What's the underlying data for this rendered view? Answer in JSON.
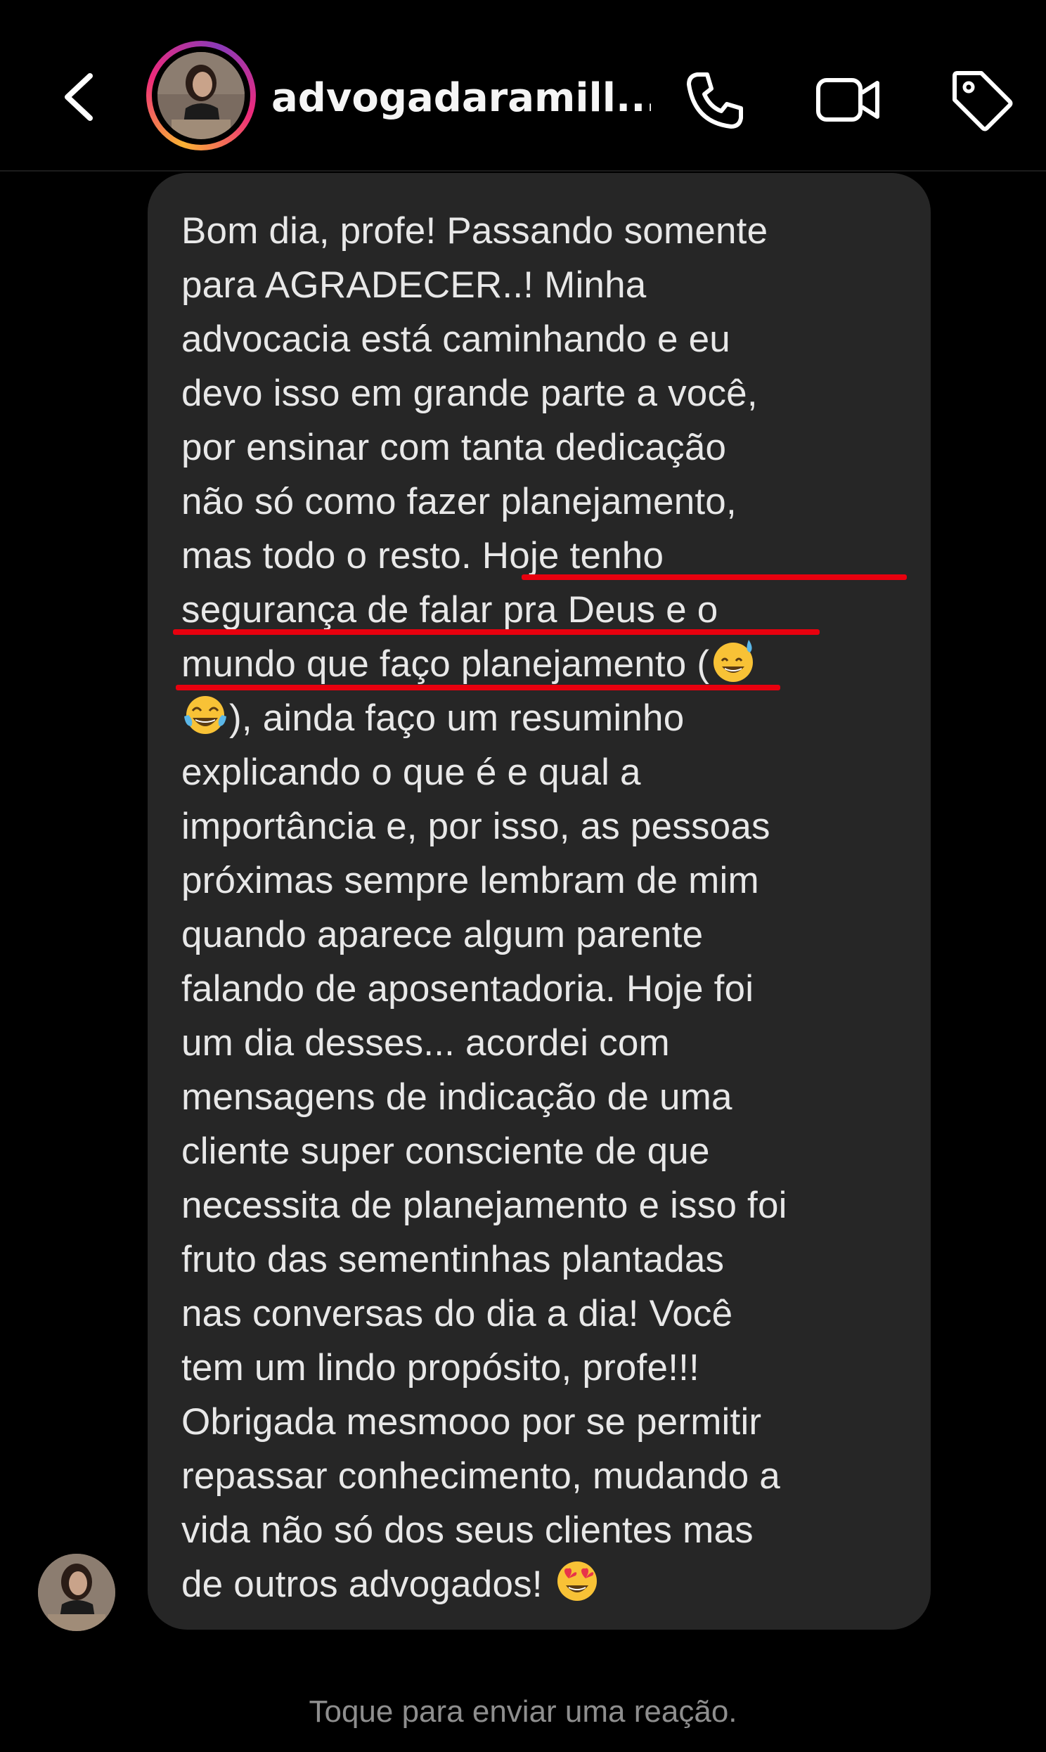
{
  "header": {
    "back_icon": "chevron-left-icon",
    "username": "advogadaramill...",
    "actions": [
      {
        "icon": "phone-icon"
      },
      {
        "icon": "video-camera-icon"
      },
      {
        "icon": "tag-icon"
      }
    ]
  },
  "message": {
    "part1": "Bom dia, profe! Passando somente\npara AGRADECER..! Minha\nadvocacia está caminhando e eu\ndevo isso em grande parte a você,\npor ensinar com tanta dedicação\nnão só como fazer planejamento,\nmas todo o resto. Hoje tenho\nsegurança de falar pra Deus e o\nmundo que faço planejamento (",
    "emoji1": "grinning-sweat-emoji",
    "emoji2": "tears-of-joy-emoji",
    "part2": "), ainda faço um resuminho\nexplicando o que é e qual a\nimportância e, por isso, as pessoas\npróximas sempre lembram de mim\nquando aparece algum parente\nfalando de aposentadoria. Hoje foi\num dia desses... acordei com\nmensagens de indicação de uma\ncliente super consciente de que\nnecessita de planejamento e isso foi\nfruto das sementinhas plantadas\nnas conversas do dia a dia! Você\ntem um lindo propósito, profe!!!\nObrigada mesmooo por se permitir\nrepassar conhecimento, mudando a\nvida não só dos seus clientes mas\nde outros advogados! ",
    "emoji3": "heart-eyes-emoji",
    "highlight_color": "#e8000e"
  },
  "footer": {
    "reaction_hint": "Toque para enviar uma reação."
  },
  "colors": {
    "background": "#000000",
    "bubble": "#262626",
    "text": "#e8e8e8",
    "muted": "#8e8e8e"
  }
}
